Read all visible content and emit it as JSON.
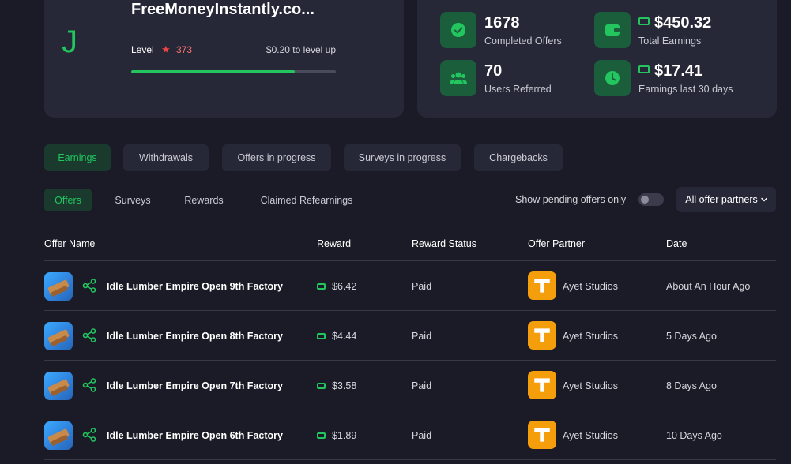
{
  "colors": {
    "background": "#1a1b26",
    "card": "#262837",
    "accent_green": "#22c55e",
    "level_red": "#f87171",
    "partner_orange": "#f59e0b"
  },
  "profile": {
    "avatar_letter": "J",
    "site_name": "FreeMoneyInstantly.co...",
    "level_label": "Level",
    "level_number": "373",
    "to_level_up": "$0.20 to level up",
    "progress_fraction": 0.8
  },
  "stats": {
    "completed": {
      "value": "1678",
      "label": "Completed Offers",
      "icon": "check-circle-icon"
    },
    "total_earnings": {
      "value": "$450.32",
      "label": "Total Earnings",
      "icon": "wallet-icon"
    },
    "referred": {
      "value": "70",
      "label": "Users Referred",
      "icon": "users-icon"
    },
    "last30": {
      "value": "$17.41",
      "label": "Earnings last 30 days",
      "icon": "clock-icon"
    }
  },
  "tabs": [
    {
      "label": "Earnings",
      "active": true
    },
    {
      "label": "Withdrawals",
      "active": false
    },
    {
      "label": "Offers in progress",
      "active": false
    },
    {
      "label": "Surveys in progress",
      "active": false
    },
    {
      "label": "Chargebacks",
      "active": false
    }
  ],
  "subtabs": [
    {
      "label": "Offers",
      "active": true
    },
    {
      "label": "Surveys",
      "active": false
    },
    {
      "label": "Rewards",
      "active": false
    },
    {
      "label": "Claimed Refearnings",
      "active": false
    }
  ],
  "filters": {
    "pending_label": "Show pending offers only",
    "pending_on": false,
    "partner_select": "All offer partners"
  },
  "table": {
    "headers": [
      "Offer Name",
      "Reward",
      "Reward Status",
      "Offer Partner",
      "Date"
    ],
    "rows": [
      {
        "name": "Idle Lumber Empire Open 9th Factory",
        "reward": "$6.42",
        "status": "Paid",
        "partner": "Ayet Studios",
        "date": "About An Hour Ago"
      },
      {
        "name": "Idle Lumber Empire Open 8th Factory",
        "reward": "$4.44",
        "status": "Paid",
        "partner": "Ayet Studios",
        "date": "5 Days Ago"
      },
      {
        "name": "Idle Lumber Empire Open 7th Factory",
        "reward": "$3.58",
        "status": "Paid",
        "partner": "Ayet Studios",
        "date": "8 Days Ago"
      },
      {
        "name": "Idle Lumber Empire Open 6th Factory",
        "reward": "$1.89",
        "status": "Paid",
        "partner": "Ayet Studios",
        "date": "10 Days Ago"
      }
    ]
  }
}
